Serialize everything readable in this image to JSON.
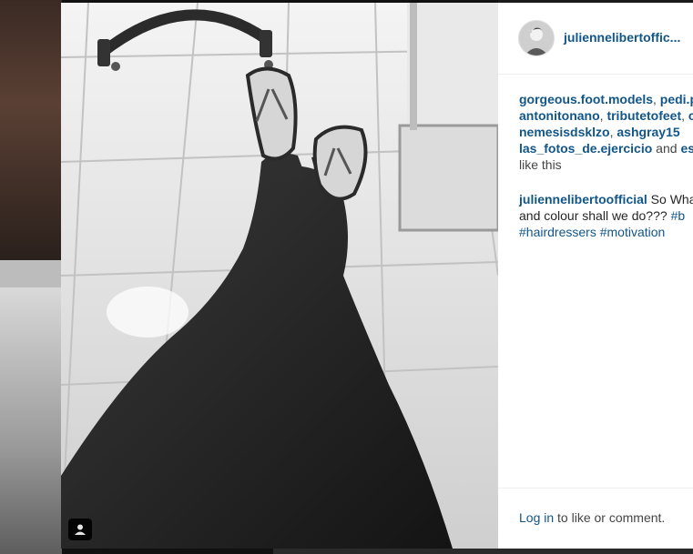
{
  "post": {
    "username": "juliennelibertoffic...",
    "likes": {
      "line1": [
        "gorgeous.foot.models",
        "pedi.p"
      ],
      "line2": [
        "antonitonano",
        "tributetofeet",
        "c"
      ],
      "line3": [
        "nemesisdsklzo",
        "ashgray15"
      ],
      "line4_user": "las_fotos_de.ejercicio",
      "line4_and": " and ",
      "line4_tail": "es",
      "line5": "like this"
    },
    "caption": {
      "author": "juliennelibertoofficial",
      "line1_text": " So Wha",
      "line2_text": "and colour shall we do??? ",
      "line2_tag": "#b",
      "line3_tags": [
        "#hairdressers",
        "#motivation"
      ]
    },
    "footer": {
      "login_link": "Log in",
      "login_rest": " to like or comment."
    }
  },
  "icons": {
    "user_tag": "person-icon",
    "avatar": "profile-photo"
  },
  "colors": {
    "link": "#125688",
    "text": "#262626",
    "border": "#efefef"
  }
}
